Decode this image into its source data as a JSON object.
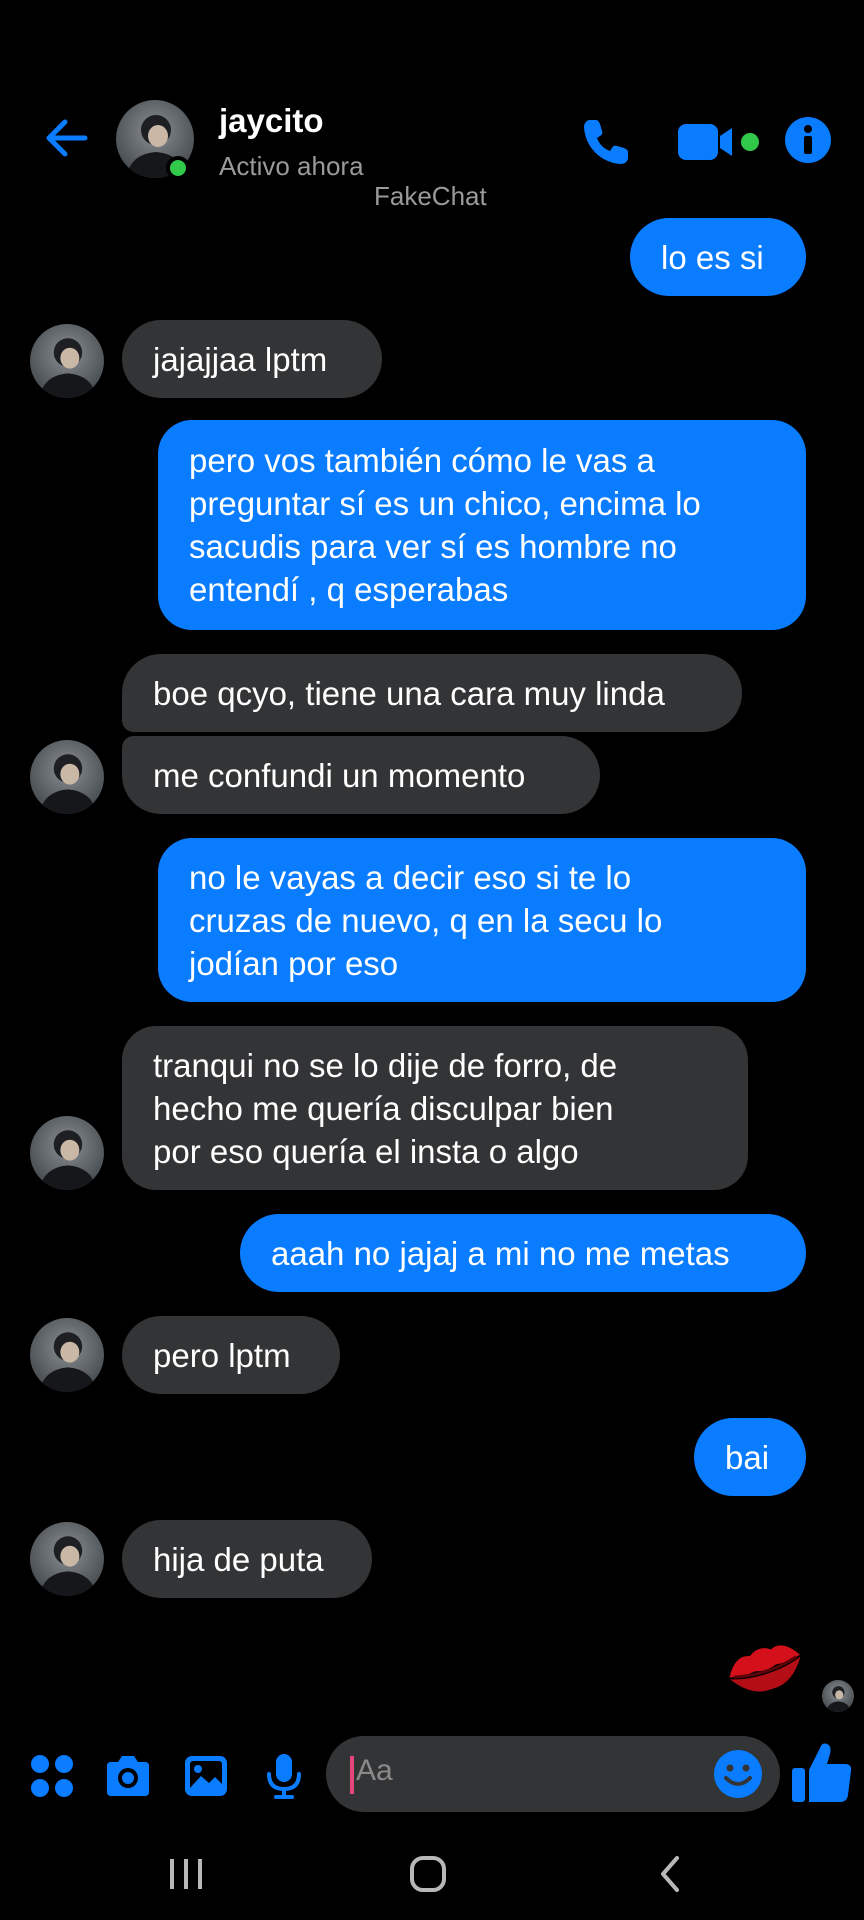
{
  "header": {
    "contact_name": "jaycito",
    "status": "Activo ahora",
    "watermark": "FakeChat"
  },
  "messages": [
    {
      "direction": "sent",
      "text": "lo es si"
    },
    {
      "direction": "received",
      "text": "jajajjaa lptm"
    },
    {
      "direction": "sent",
      "text": "pero vos también cómo le vas a\npreguntar sí es un chico, encima lo\nsacudis para ver sí es hombre no\nentendí , q esperabas"
    },
    {
      "direction": "received",
      "text": "boe qcyo, tiene una cara muy linda"
    },
    {
      "direction": "received",
      "text": "me confundi un momento"
    },
    {
      "direction": "sent",
      "text": "no le vayas a decir eso si te lo\ncruzas de nuevo, q en la secu lo\njodían por eso"
    },
    {
      "direction": "received",
      "text": "tranqui no se lo dije de forro, de\nhecho me quería disculpar bien\npor eso quería el insta o algo"
    },
    {
      "direction": "sent",
      "text": "aaah no jajaj a mi no me metas"
    },
    {
      "direction": "received",
      "text": "pero lptm"
    },
    {
      "direction": "sent",
      "text": "bai"
    },
    {
      "direction": "received",
      "text": "hija de puta"
    }
  ],
  "composer": {
    "placeholder": "Aa"
  },
  "icons": {
    "back": "arrow-left-icon",
    "call": "phone-icon",
    "video": "video-camera-icon",
    "info": "info-icon",
    "apps": "four-dots-icon",
    "camera": "camera-icon",
    "gallery": "image-icon",
    "mic": "microphone-icon",
    "emoji": "smiley-icon",
    "like": "thumbs-up-icon",
    "sticker": "kiss-lips-icon"
  },
  "colors": {
    "accent": "#0a7cff",
    "received_bubble": "#333436",
    "online": "#31c94a",
    "background": "#000000",
    "kiss": "#d4111b"
  }
}
